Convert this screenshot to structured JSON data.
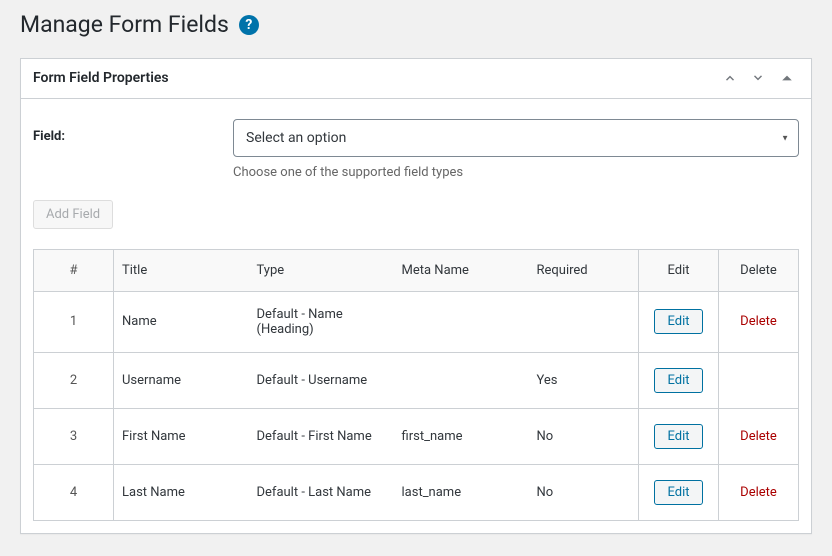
{
  "page_title": "Manage Form Fields",
  "panel_title": "Form Field Properties",
  "field_row": {
    "label": "Field:",
    "select_placeholder": "Select an option",
    "description": "Choose one of the supported field types"
  },
  "add_field_label": "Add Field",
  "table": {
    "headers": {
      "index": "#",
      "title": "Title",
      "type": "Type",
      "meta": "Meta Name",
      "required": "Required",
      "edit": "Edit",
      "delete": "Delete"
    },
    "edit_label": "Edit",
    "delete_label": "Delete",
    "rows": [
      {
        "index": "1",
        "title": "Name",
        "type": "Default - Name (Heading)",
        "meta": "",
        "required": "",
        "editable": true,
        "deletable": true
      },
      {
        "index": "2",
        "title": "Username",
        "type": "Default - Username",
        "meta": "",
        "required": "Yes",
        "editable": true,
        "deletable": false
      },
      {
        "index": "3",
        "title": "First Name",
        "type": "Default - First Name",
        "meta": "first_name",
        "required": "No",
        "editable": true,
        "deletable": true
      },
      {
        "index": "4",
        "title": "Last Name",
        "type": "Default - Last Name",
        "meta": "last_name",
        "required": "No",
        "editable": true,
        "deletable": true
      }
    ]
  }
}
